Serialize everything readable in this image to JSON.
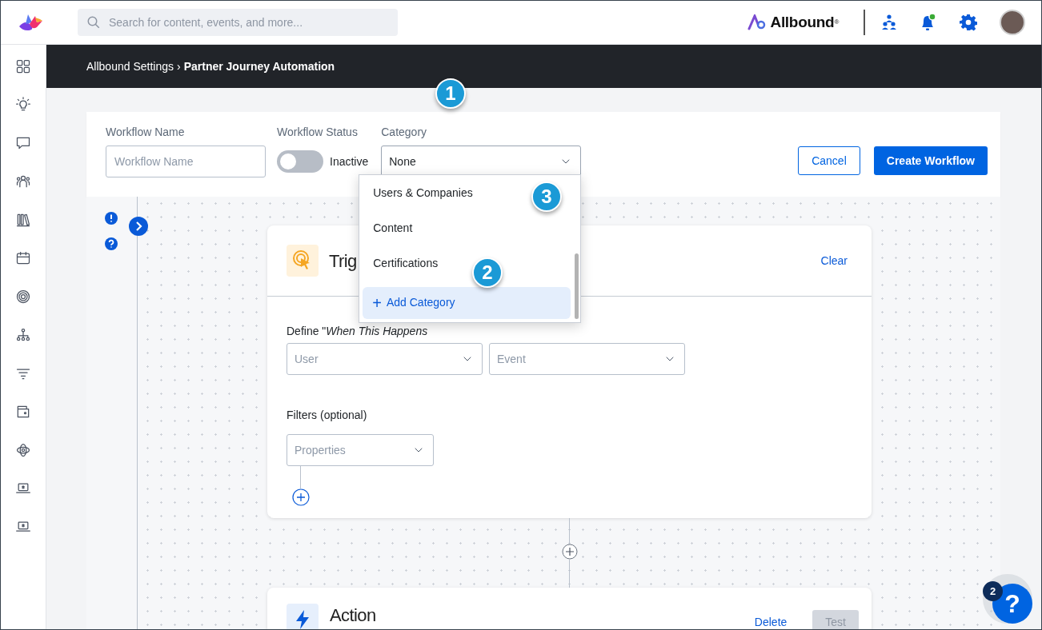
{
  "header": {
    "search": {
      "placeholder": "Search for content, events, and more..."
    },
    "brand": "Allbound$^{®}$",
    "notifications": {
      "unread": true
    }
  },
  "breadcrumb": {
    "items": [
      "Allbound Settings",
      "Partner Journey Automation"
    ],
    "separator": "›"
  },
  "sidebar": {
    "items": [
      {
        "kind": "grid"
      },
      {
        "kind": "bulb"
      },
      {
        "kind": "chat"
      },
      {
        "kind": "people"
      },
      {
        "kind": "library"
      },
      {
        "kind": "calendar"
      },
      {
        "kind": "target"
      },
      {
        "kind": "org"
      },
      {
        "kind": "filter"
      },
      {
        "kind": "wallet"
      },
      {
        "kind": "orbit"
      },
      {
        "kind": "laptop"
      },
      {
        "kind": "laptop"
      }
    ]
  },
  "form": {
    "name": {
      "label": "Workflow Name",
      "placeholder": "Workflow Name"
    },
    "status": {
      "label": "Workflow Status",
      "on": false,
      "text": "Inactive"
    },
    "category": {
      "label": "Category",
      "value": "None",
      "expanded": true,
      "options": [
        {
          "label": "Users & Companies",
          "selected": false
        },
        {
          "label": "Content",
          "selected": false
        },
        {
          "label": "Certifications",
          "selected": false
        }
      ],
      "add": {
        "icon": "+",
        "label": "Add Category",
        "highlighted": true
      }
    },
    "buttons": [
      {
        "label": "Cancel",
        "kind": "outline"
      },
      {
        "label": "Create Workflow",
        "kind": "primary"
      }
    ]
  },
  "callouts": [
    "1",
    "2",
    "3"
  ],
  "trigger": {
    "title": "Trig",
    "action": "Clear",
    "define_label": "Define \"*When This Happens*",
    "selects": [
      {
        "placeholder": "User"
      },
      {
        "placeholder": "Event"
      }
    ],
    "filters_label": "Filters (optional)",
    "filter_select": {
      "placeholder": "Properties"
    }
  },
  "action": {
    "title": "Action",
    "buttons": [
      {
        "label": "Delete",
        "disabled": false
      },
      {
        "label": "Test",
        "disabled": true
      }
    ]
  },
  "help": {
    "label": "?",
    "badge": "2"
  }
}
